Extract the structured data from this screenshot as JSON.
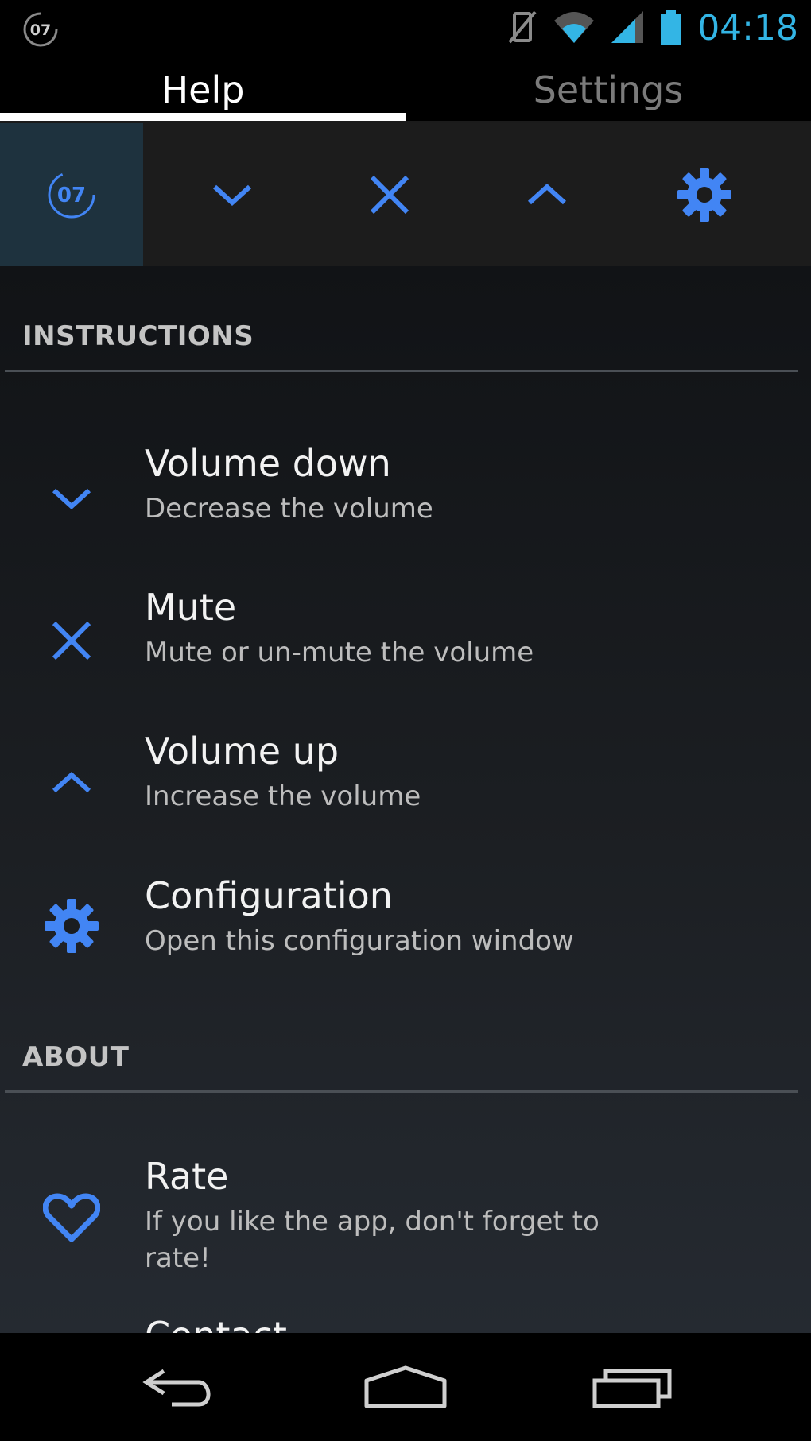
{
  "status_bar": {
    "notification_badge": "07",
    "icons": [
      "vibrate-icon",
      "wifi-icon",
      "signal-icon",
      "battery-icon"
    ],
    "time": "04:18"
  },
  "tabs": [
    {
      "label": "Help",
      "selected": true
    },
    {
      "label": "Settings",
      "selected": false
    }
  ],
  "toolbar": {
    "badge_value": "07",
    "buttons": [
      "volume-down-icon",
      "mute-icon",
      "volume-up-icon",
      "settings-icon"
    ]
  },
  "sections": {
    "instructions": {
      "header": "INSTRUCTIONS",
      "items": [
        {
          "icon": "chevron-down-icon",
          "title": "Volume down",
          "desc": "Decrease the volume"
        },
        {
          "icon": "close-icon",
          "title": "Mute",
          "desc": "Mute or un-mute the volume"
        },
        {
          "icon": "chevron-up-icon",
          "title": "Volume up",
          "desc": "Increase the volume"
        },
        {
          "icon": "gear-icon",
          "title": "Configuration",
          "desc": "Open this configuration window"
        }
      ]
    },
    "about": {
      "header": "ABOUT",
      "items": [
        {
          "icon": "heart-icon",
          "title": "Rate",
          "desc": "If you like the app, don't forget to rate!"
        },
        {
          "icon": "",
          "title": "Contact",
          "desc": ""
        }
      ]
    }
  },
  "colors": {
    "accent": "#4285f4",
    "status_time": "#33b5e5",
    "active_tool_bg": "#1e323e"
  },
  "nav_bar": [
    "back-icon",
    "home-icon",
    "recent-apps-icon"
  ]
}
